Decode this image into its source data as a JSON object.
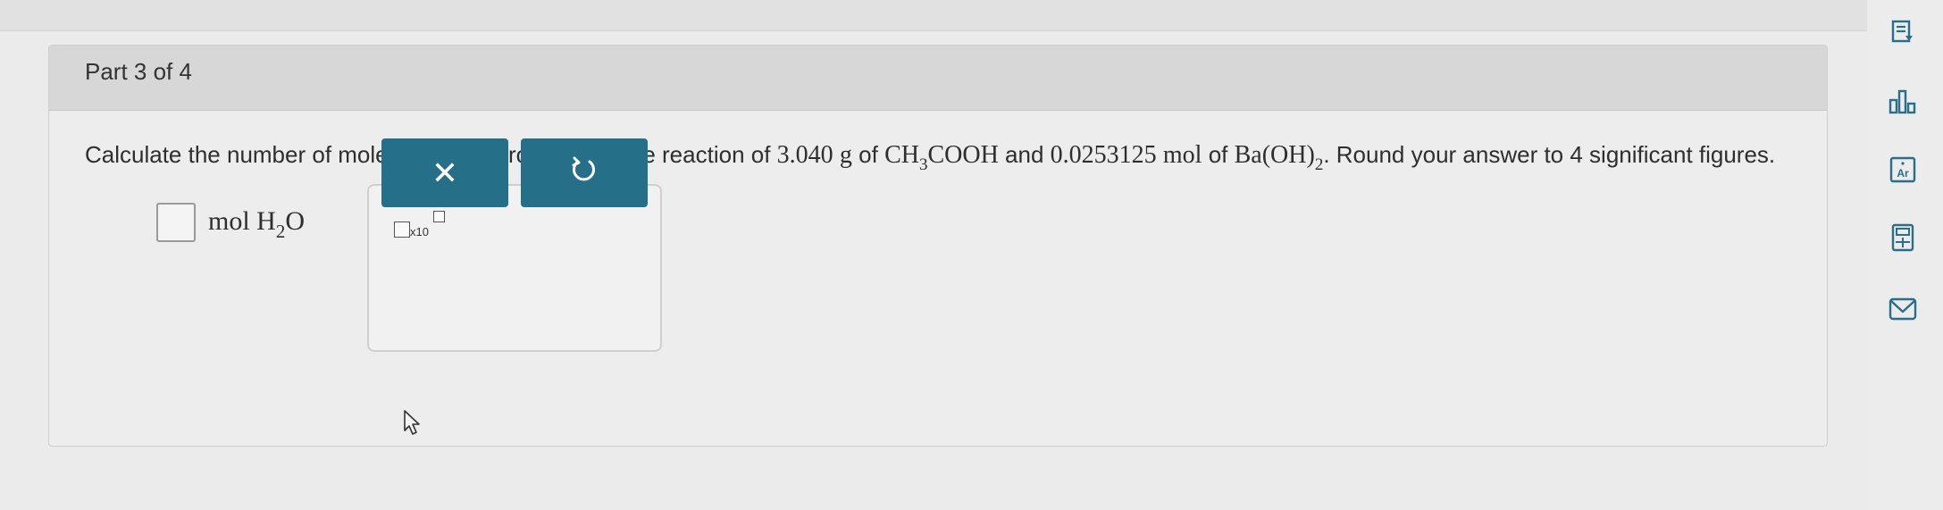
{
  "question": {
    "part_label": "Part 3 of 4",
    "intro": "Calculate the number of moles of water produced in the reaction of",
    "mass_value": "3.040",
    "mass_unit": "g",
    "of_word": "of",
    "acid_pre": "CH",
    "acid_sub": "3",
    "acid_post": "COOH",
    "and_word": "and",
    "mol_value": "0.0253125",
    "mol_unit": "mol",
    "of_word2": "of",
    "base_pre": "Ba",
    "base_paren": "(OH)",
    "base_sub": "2",
    "suffix": ". Round your answer to 4 significant figures."
  },
  "answer": {
    "value": "",
    "unit_pre": "mol H",
    "unit_sub": "2",
    "unit_post": "O"
  },
  "tool_panel": {
    "x10_label": "x10",
    "clear_symbol": "✕",
    "undo_symbol": "↺"
  },
  "sidebar": {
    "icons": [
      "worksheet-icon",
      "bar-chart-icon",
      "periodic-table-icon",
      "calculator-icon",
      "mail-icon"
    ],
    "periodic_label": "Ar"
  },
  "colors": {
    "button_bg": "#266f88",
    "header_bg": "#d7d7d7",
    "card_bg": "#ededed",
    "sidebar_icon": "#2a6f8a"
  }
}
